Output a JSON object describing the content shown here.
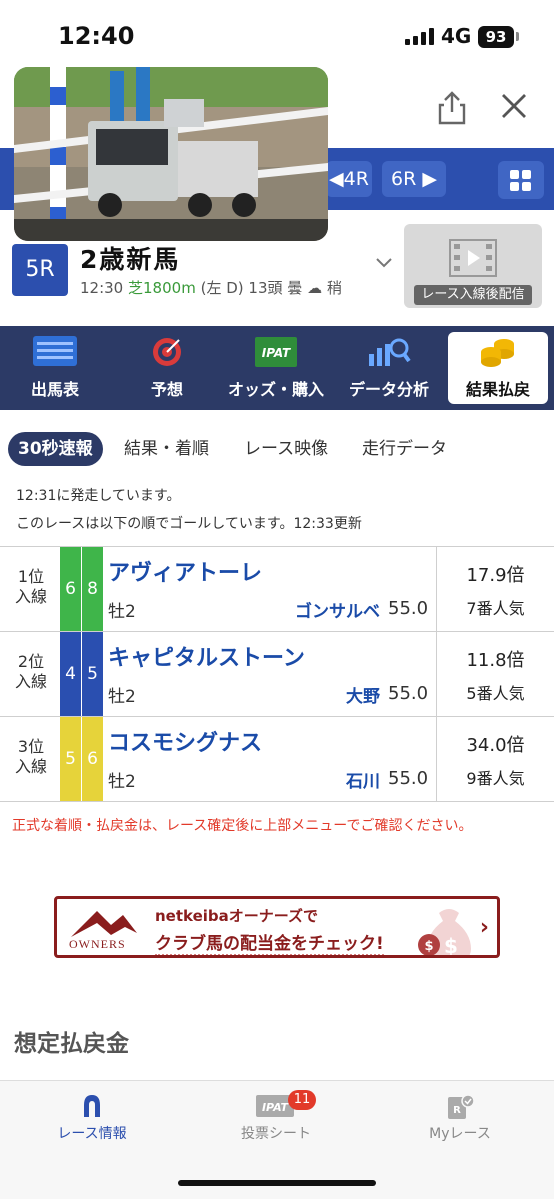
{
  "status_bar": {
    "time": "12:40",
    "network": "4G",
    "battery": "93"
  },
  "race_nav": {
    "prev": "4R",
    "next": "6R"
  },
  "race": {
    "number": "5R",
    "name": "2歳新馬",
    "start_time": "12:30",
    "course": "芝1800m",
    "direction": "(左 D)",
    "runners": "13頭",
    "weather": "曇",
    "track": "稍",
    "live_label": "レース入線後配信"
  },
  "menu": [
    {
      "label": "出馬表",
      "icon": "table-icon"
    },
    {
      "label": "予想",
      "icon": "target-icon"
    },
    {
      "label": "オッズ・購入",
      "icon": "ipat-icon"
    },
    {
      "label": "データ分析",
      "icon": "chart-search-icon"
    },
    {
      "label": "結果払戻",
      "icon": "coins-icon"
    }
  ],
  "subtabs": [
    "30秒速報",
    "結果・着順",
    "レース映像",
    "走行データ"
  ],
  "info": {
    "line1": "12:31に発走しています。",
    "line2": "このレースは以下の順でゴールしています。12:33更新"
  },
  "results": [
    {
      "pos": "1位",
      "status": "入線",
      "waku": "6",
      "umaban": "8",
      "waku_color": "#3fb54a",
      "horse": "アヴィアトーレ",
      "sex_age": "牡2",
      "jockey": "ゴンサルベ",
      "weight": "55.0",
      "odds": "17.9倍",
      "popularity": "7番人気"
    },
    {
      "pos": "2位",
      "status": "入線",
      "waku": "4",
      "umaban": "5",
      "waku_color": "#2a4fb0",
      "horse": "キャピタルストーン",
      "sex_age": "牡2",
      "jockey": "大野",
      "weight": "55.0",
      "odds": "11.8倍",
      "popularity": "5番人気"
    },
    {
      "pos": "3位",
      "status": "入線",
      "waku": "5",
      "umaban": "6",
      "waku_color": "#e6d33a",
      "horse": "コスモシグナス",
      "sex_age": "牡2",
      "jockey": "石川",
      "weight": "55.0",
      "odds": "34.0倍",
      "popularity": "9番人気"
    }
  ],
  "notice": "正式な着順・払戻金は、レース確定後に上部メニューでご確認ください。",
  "banner": {
    "logo": "OWNERS",
    "line1": "netkeibaオーナーズで",
    "line2": "クラブ馬の配当金をチェック!"
  },
  "section_title": "想定払戻金",
  "bottom_nav": [
    {
      "label": "レース情報",
      "icon": "horseshoe-icon"
    },
    {
      "label": "投票シート",
      "icon": "ipat-sheet-icon",
      "badge": "11"
    },
    {
      "label": "Myレース",
      "icon": "my-race-icon"
    }
  ]
}
